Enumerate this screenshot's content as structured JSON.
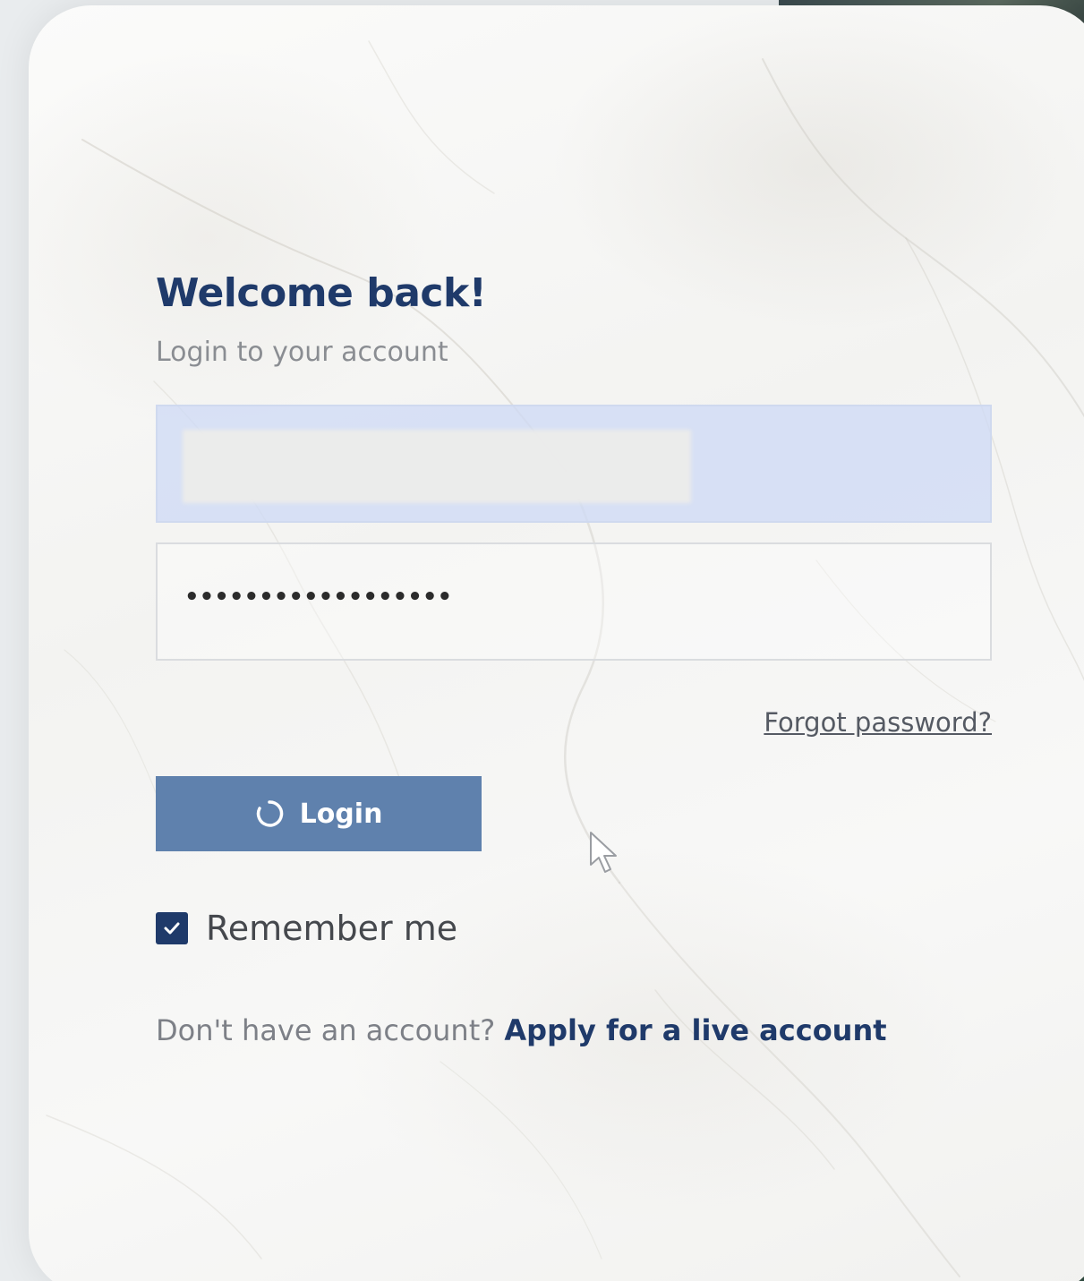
{
  "header": {
    "title": "Welcome back!",
    "subtitle": "Login to your account"
  },
  "form": {
    "username_value": "",
    "password_mask": "••••••••••••••••••",
    "forgot_label": "Forgot password?",
    "login_label": "Login",
    "login_state": "loading",
    "remember_label": "Remember me",
    "remember_checked": true
  },
  "footer": {
    "prompt": "Don't have an account?",
    "link_label": "Apply for a live account"
  },
  "colors": {
    "primary": "#1f3a6a",
    "button": "#5f81ad",
    "username_field": "#cddaf5"
  },
  "icons": {
    "spinner": "spinner-icon",
    "checkbox": "checkmark-icon",
    "cursor": "mouse-pointer-icon"
  }
}
